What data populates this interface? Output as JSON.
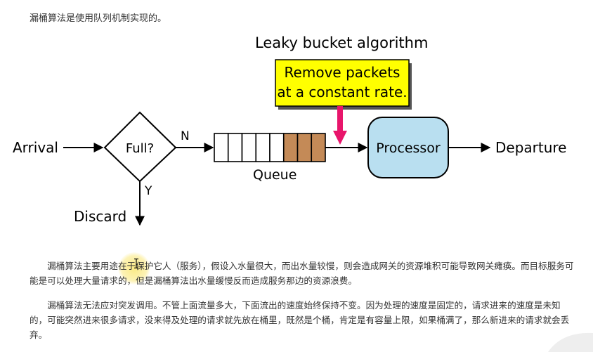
{
  "intro_text": "漏桶算法是使用队列机制实现的。",
  "diagram": {
    "title": "Leaky bucket algorithm",
    "callout_line1": "Remove packets",
    "callout_line2": "at a constant rate.",
    "arrival_label": "Arrival",
    "decision_label": "Full?",
    "no_label": "N",
    "yes_label": "Y",
    "discard_label": "Discard",
    "queue_label": "Queue",
    "processor_label": "Processor",
    "departure_label": "Departure",
    "queue_slots_total": 8,
    "queue_slots_filled": 3,
    "colors": {
      "callout_bg": "#ffff00",
      "arrow_pink": "#e8156b",
      "queue_filled": "#c48a57",
      "processor_bg": "#b9dff0"
    }
  },
  "paragraphs": [
    "漏桶算法主要用途在于保护它人（服务），假设入水量很大，而出水量较慢，则会造成网关的资源堆积可能导致网关瘫痪。而目标服务可能是可以处理大量请求的，但是漏桶算法出水量缓慢反而造成服务那边的资源浪费。",
    "漏桶算法无法应对突发调用。不管上面流量多大，下面流出的速度始终保持不变。因为处理的速度是固定的，请求进来的速度是未知的，可能突然进来很多请求，没来得及处理的请求就先放在桶里，既然是个桶，肯定是有容量上限，如果桶满了，那么新进来的请求就会丢弃。"
  ],
  "icons": [
    "text-cursor-icon"
  ]
}
